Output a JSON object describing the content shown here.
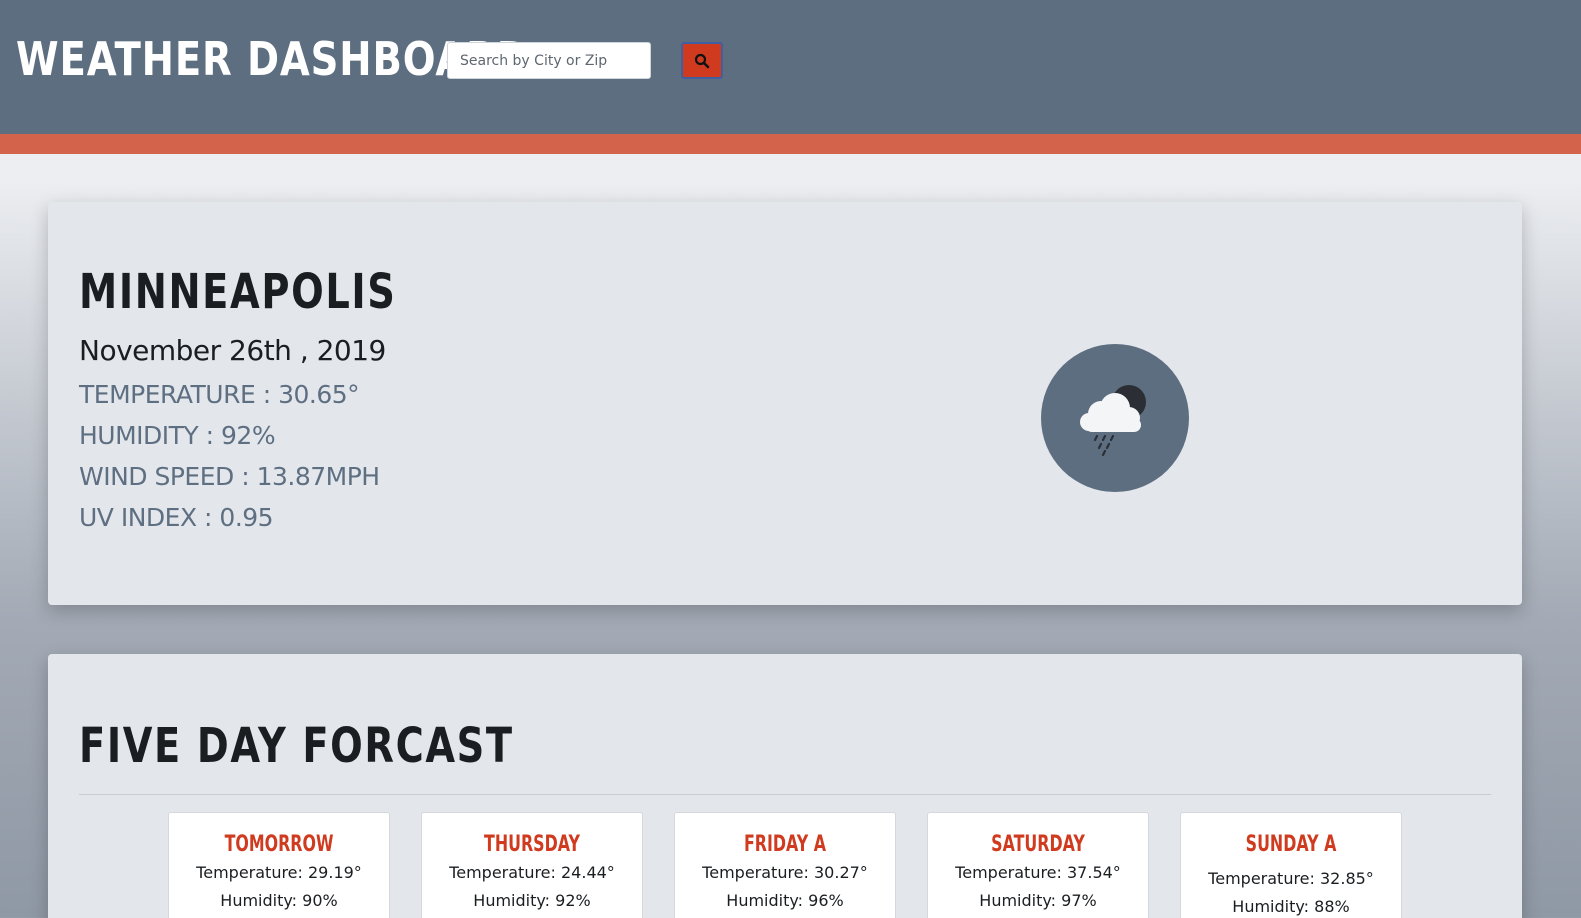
{
  "header": {
    "title": "Weather Dashboard",
    "search_placeholder": "Search by City or Zip",
    "search_value": "",
    "search_button_icon": "search-icon"
  },
  "colors": {
    "header_bg": "#5e6e81",
    "accent_bar": "#d3644b",
    "button_bg": "#d03b1f",
    "day_name": "#d03b1f",
    "stat_text": "#5f6f82"
  },
  "current": {
    "city": "Minneapolis",
    "date": "November 26th , 2019",
    "temperature": "TEMPERATURE : 30.65°",
    "humidity": "HUMIDITY : 92%",
    "wind_speed": "WIND SPEED : 13.87MPH",
    "uv_index": "UV  INDEX : 0.95",
    "icon": "cloud-rain-night-icon"
  },
  "forecast": {
    "title": "Five Day Forcast",
    "days": [
      {
        "name": "Tomorrow",
        "temperature": "Temperature: 29.19°",
        "humidity": "Humidity: 90%"
      },
      {
        "name": "Thursday",
        "temperature": "Temperature: 24.44°",
        "humidity": "Humidity: 92%"
      },
      {
        "name": "Friday A",
        "temperature": "Temperature: 30.27°",
        "humidity": "Humidity: 96%"
      },
      {
        "name": "Saturday",
        "temperature": "Temperature: 37.54°",
        "humidity": "Humidity: 97%"
      },
      {
        "name": "Sunday A",
        "temperature": "Temperature: 32.85°",
        "humidity": "Humidity: 88%"
      }
    ]
  }
}
